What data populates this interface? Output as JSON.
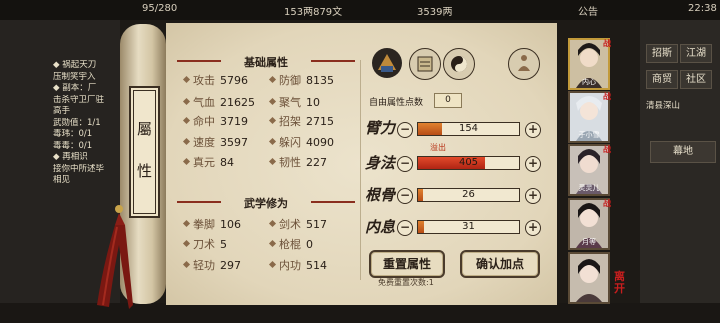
{
  "topbar": {
    "fatigue": "95/280",
    "money": "153两879文",
    "gold": "3539两",
    "notice": "公告",
    "time": "22:38"
  },
  "quest": {
    "lines": [
      "◆ 祸起天刀",
      "压制笑宇入",
      "◆ 副本：厂",
      "击杀守卫厂驻",
      "高手",
      "武勋值：1/1",
      "毒玮：0/1",
      "毒毒：0/1",
      "◆ 再相识",
      "接你中所述毕",
      "相见"
    ]
  },
  "side": {
    "buttons": [
      "招斯",
      "江湖",
      "商贸",
      "社区"
    ],
    "location": "清县深山",
    "location2": "幕地"
  },
  "scroll": {
    "title_chars": [
      "屬",
      "性"
    ]
  },
  "basic": {
    "heading": "基础属性",
    "stats": [
      {
        "label": "攻击",
        "value": "5796"
      },
      {
        "label": "防御",
        "value": "8135"
      },
      {
        "label": "气血",
        "value": "21625"
      },
      {
        "label": "聚气",
        "value": "10"
      },
      {
        "label": "命中",
        "value": "3719"
      },
      {
        "label": "招架",
        "value": "2715"
      },
      {
        "label": "速度",
        "value": "3597"
      },
      {
        "label": "躲闪",
        "value": "4090"
      },
      {
        "label": "真元",
        "value": "84"
      },
      {
        "label": "韧性",
        "value": "227"
      }
    ]
  },
  "martial": {
    "heading": "武学修为",
    "stats": [
      {
        "label": "拳脚",
        "value": "106"
      },
      {
        "label": "剑术",
        "value": "517"
      },
      {
        "label": "刀术",
        "value": "5"
      },
      {
        "label": "枪棍",
        "value": "0"
      },
      {
        "label": "轻功",
        "value": "297"
      },
      {
        "label": "内功",
        "value": "514"
      }
    ]
  },
  "alloc": {
    "free_label": "自由属性点数",
    "free_value": "0",
    "overflow_label": "溢出",
    "rows": [
      {
        "label": "臂力",
        "value": "154",
        "fill": 0.24,
        "overflow": false
      },
      {
        "label": "身法",
        "value": "405",
        "fill": 0.66,
        "overflow": true
      },
      {
        "label": "根骨",
        "value": "26",
        "fill": 0.05,
        "overflow": false
      },
      {
        "label": "内息",
        "value": "31",
        "fill": 0.06,
        "overflow": false
      }
    ],
    "reset_label": "重置属性",
    "confirm_label": "确认加点",
    "reset_note": "免费重置次数:1"
  },
  "party": {
    "members": [
      {
        "name": "内心",
        "battle": "战"
      },
      {
        "name": "于小雪",
        "battle": "战"
      },
      {
        "name": "灵灵儿",
        "battle": "战"
      },
      {
        "name": "月等",
        "battle": "战"
      },
      {
        "name": "",
        "battle": ""
      }
    ],
    "leave_label": "离开"
  },
  "colors": {
    "accent": "#8a2e1e",
    "bar_fill": "#d06a22",
    "parchment": "#e7dcc3"
  }
}
